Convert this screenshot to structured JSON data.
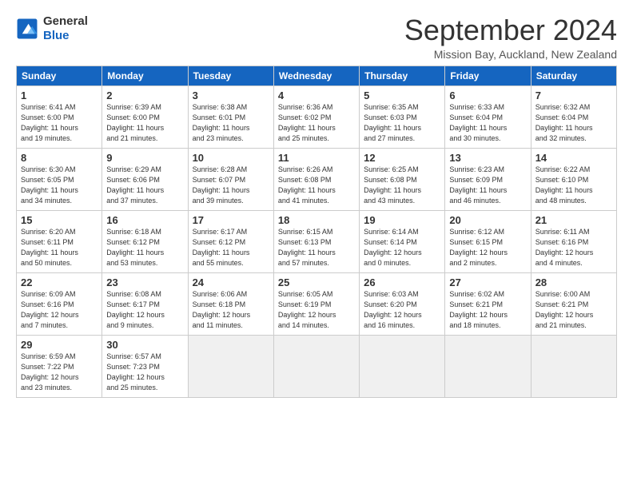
{
  "logo": {
    "line1": "General",
    "line2": "Blue"
  },
  "title": "September 2024",
  "subtitle": "Mission Bay, Auckland, New Zealand",
  "headers": [
    "Sunday",
    "Monday",
    "Tuesday",
    "Wednesday",
    "Thursday",
    "Friday",
    "Saturday"
  ],
  "weeks": [
    [
      {
        "num": "1",
        "info": "Sunrise: 6:41 AM\nSunset: 6:00 PM\nDaylight: 11 hours\nand 19 minutes."
      },
      {
        "num": "2",
        "info": "Sunrise: 6:39 AM\nSunset: 6:00 PM\nDaylight: 11 hours\nand 21 minutes."
      },
      {
        "num": "3",
        "info": "Sunrise: 6:38 AM\nSunset: 6:01 PM\nDaylight: 11 hours\nand 23 minutes."
      },
      {
        "num": "4",
        "info": "Sunrise: 6:36 AM\nSunset: 6:02 PM\nDaylight: 11 hours\nand 25 minutes."
      },
      {
        "num": "5",
        "info": "Sunrise: 6:35 AM\nSunset: 6:03 PM\nDaylight: 11 hours\nand 27 minutes."
      },
      {
        "num": "6",
        "info": "Sunrise: 6:33 AM\nSunset: 6:04 PM\nDaylight: 11 hours\nand 30 minutes."
      },
      {
        "num": "7",
        "info": "Sunrise: 6:32 AM\nSunset: 6:04 PM\nDaylight: 11 hours\nand 32 minutes."
      }
    ],
    [
      {
        "num": "8",
        "info": "Sunrise: 6:30 AM\nSunset: 6:05 PM\nDaylight: 11 hours\nand 34 minutes."
      },
      {
        "num": "9",
        "info": "Sunrise: 6:29 AM\nSunset: 6:06 PM\nDaylight: 11 hours\nand 37 minutes."
      },
      {
        "num": "10",
        "info": "Sunrise: 6:28 AM\nSunset: 6:07 PM\nDaylight: 11 hours\nand 39 minutes."
      },
      {
        "num": "11",
        "info": "Sunrise: 6:26 AM\nSunset: 6:08 PM\nDaylight: 11 hours\nand 41 minutes."
      },
      {
        "num": "12",
        "info": "Sunrise: 6:25 AM\nSunset: 6:08 PM\nDaylight: 11 hours\nand 43 minutes."
      },
      {
        "num": "13",
        "info": "Sunrise: 6:23 AM\nSunset: 6:09 PM\nDaylight: 11 hours\nand 46 minutes."
      },
      {
        "num": "14",
        "info": "Sunrise: 6:22 AM\nSunset: 6:10 PM\nDaylight: 11 hours\nand 48 minutes."
      }
    ],
    [
      {
        "num": "15",
        "info": "Sunrise: 6:20 AM\nSunset: 6:11 PM\nDaylight: 11 hours\nand 50 minutes."
      },
      {
        "num": "16",
        "info": "Sunrise: 6:18 AM\nSunset: 6:12 PM\nDaylight: 11 hours\nand 53 minutes."
      },
      {
        "num": "17",
        "info": "Sunrise: 6:17 AM\nSunset: 6:12 PM\nDaylight: 11 hours\nand 55 minutes."
      },
      {
        "num": "18",
        "info": "Sunrise: 6:15 AM\nSunset: 6:13 PM\nDaylight: 11 hours\nand 57 minutes."
      },
      {
        "num": "19",
        "info": "Sunrise: 6:14 AM\nSunset: 6:14 PM\nDaylight: 12 hours\nand 0 minutes."
      },
      {
        "num": "20",
        "info": "Sunrise: 6:12 AM\nSunset: 6:15 PM\nDaylight: 12 hours\nand 2 minutes."
      },
      {
        "num": "21",
        "info": "Sunrise: 6:11 AM\nSunset: 6:16 PM\nDaylight: 12 hours\nand 4 minutes."
      }
    ],
    [
      {
        "num": "22",
        "info": "Sunrise: 6:09 AM\nSunset: 6:16 PM\nDaylight: 12 hours\nand 7 minutes."
      },
      {
        "num": "23",
        "info": "Sunrise: 6:08 AM\nSunset: 6:17 PM\nDaylight: 12 hours\nand 9 minutes."
      },
      {
        "num": "24",
        "info": "Sunrise: 6:06 AM\nSunset: 6:18 PM\nDaylight: 12 hours\nand 11 minutes."
      },
      {
        "num": "25",
        "info": "Sunrise: 6:05 AM\nSunset: 6:19 PM\nDaylight: 12 hours\nand 14 minutes."
      },
      {
        "num": "26",
        "info": "Sunrise: 6:03 AM\nSunset: 6:20 PM\nDaylight: 12 hours\nand 16 minutes."
      },
      {
        "num": "27",
        "info": "Sunrise: 6:02 AM\nSunset: 6:21 PM\nDaylight: 12 hours\nand 18 minutes."
      },
      {
        "num": "28",
        "info": "Sunrise: 6:00 AM\nSunset: 6:21 PM\nDaylight: 12 hours\nand 21 minutes."
      }
    ],
    [
      {
        "num": "29",
        "info": "Sunrise: 6:59 AM\nSunset: 7:22 PM\nDaylight: 12 hours\nand 23 minutes."
      },
      {
        "num": "30",
        "info": "Sunrise: 6:57 AM\nSunset: 7:23 PM\nDaylight: 12 hours\nand 25 minutes."
      },
      {
        "num": "",
        "info": ""
      },
      {
        "num": "",
        "info": ""
      },
      {
        "num": "",
        "info": ""
      },
      {
        "num": "",
        "info": ""
      },
      {
        "num": "",
        "info": ""
      }
    ]
  ]
}
